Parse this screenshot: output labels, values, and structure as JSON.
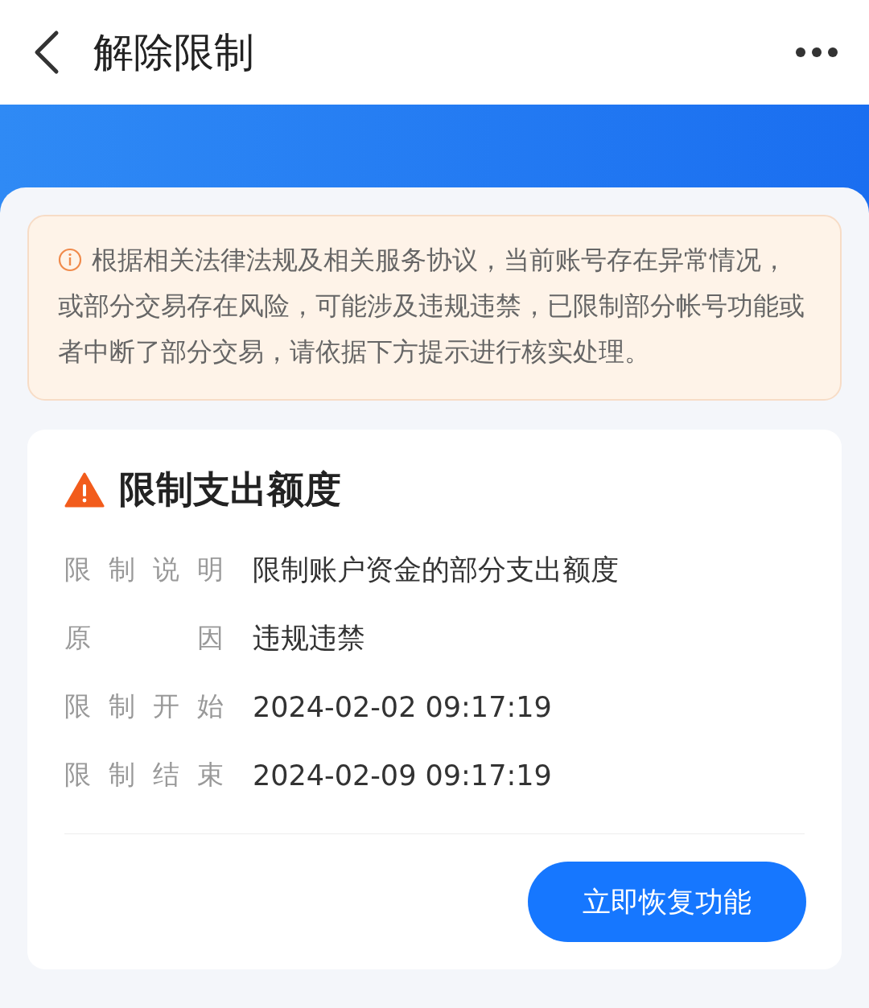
{
  "header": {
    "title": "解除限制"
  },
  "notice": {
    "text": "根据相关法律法规及相关服务协议，当前账号存在异常情况，或部分交易存在风险，可能涉及违规违禁，已限制部分帐号功能或者中断了部分交易，请依据下方提示进行核实处理。"
  },
  "restriction": {
    "title": "限制支出额度",
    "rows": [
      {
        "label": "限制说明",
        "value": "限制账户资金的部分支出额度"
      },
      {
        "label": "原因",
        "value": "违规违禁"
      },
      {
        "label": "限制开始",
        "value": "2024-02-02 09:17:19"
      },
      {
        "label": "限制结束",
        "value": "2024-02-09 09:17:19"
      }
    ],
    "button": "立即恢复功能"
  }
}
